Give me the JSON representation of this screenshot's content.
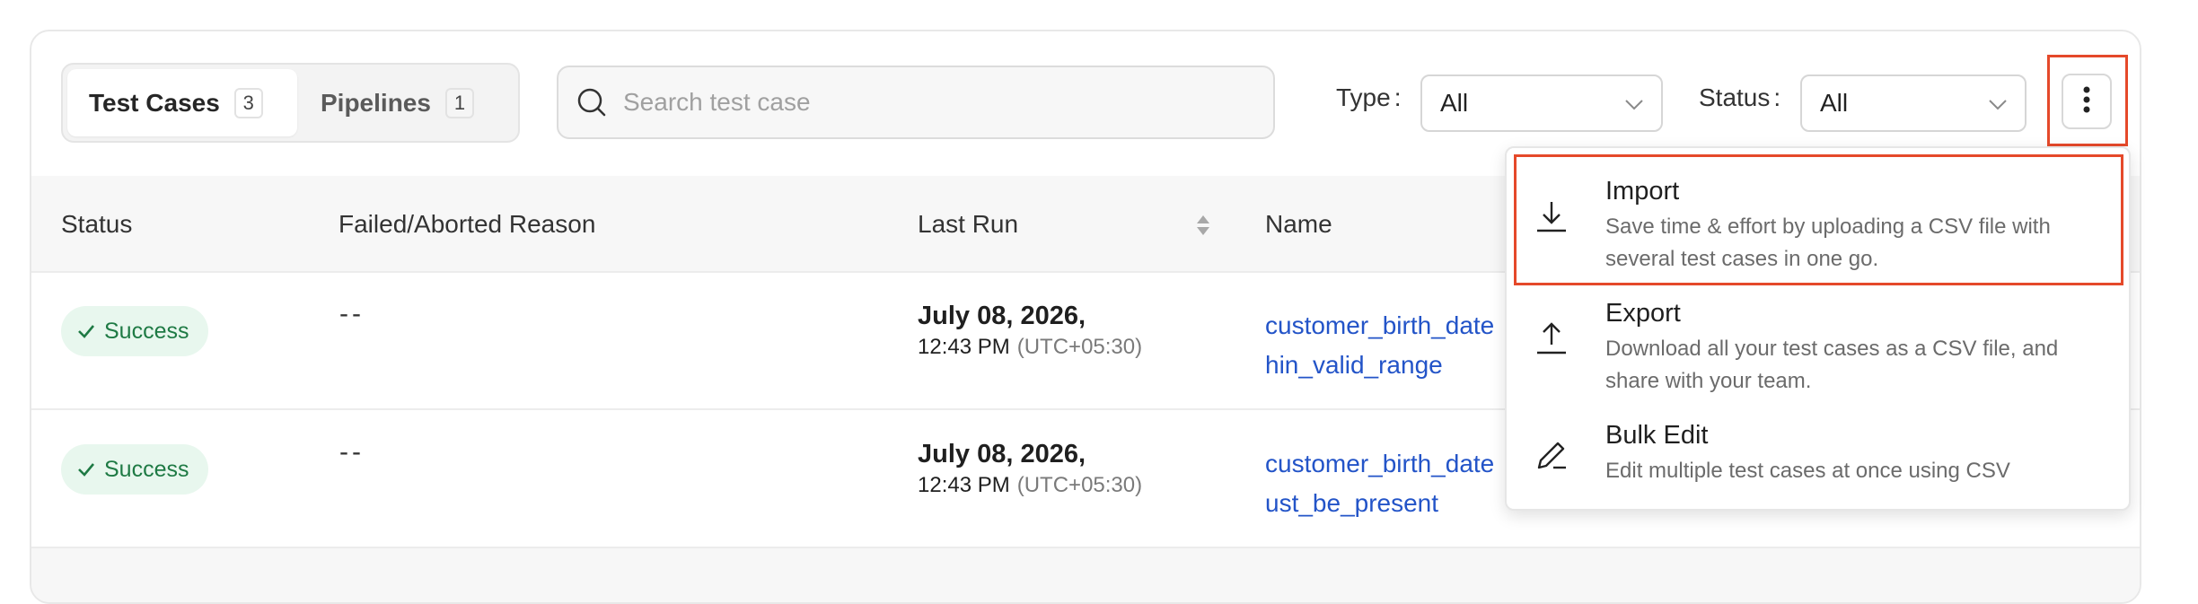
{
  "tabs": [
    {
      "label": "Test Cases",
      "count": "3"
    },
    {
      "label": "Pipelines",
      "count": "1"
    }
  ],
  "search": {
    "placeholder": "Search test case",
    "icon": "search-icon"
  },
  "filters": {
    "type": {
      "label": "Type",
      "colon": ":",
      "value": "All"
    },
    "status": {
      "label": "Status",
      "colon": ":",
      "value": "All"
    }
  },
  "more_button": {
    "icon": "kebab-vertical-icon"
  },
  "table": {
    "headers": [
      "Status",
      "Failed/Aborted Reason",
      "Last Run",
      "Name"
    ],
    "rows": [
      {
        "status": "Success",
        "reason": "--",
        "date": "July 08, 2026,",
        "time": "12:43 PM",
        "tz": "(UTC+05:30)",
        "name_line1": "customer_birth_date",
        "name_line2": "hin_valid_range"
      },
      {
        "status": "Success",
        "reason": "--",
        "date": "July 08, 2026,",
        "time": "12:43 PM",
        "tz": "(UTC+05:30)",
        "name_line1": "customer_birth_date",
        "name_line2": "ust_be_present"
      }
    ]
  },
  "menu": {
    "items": [
      {
        "title": "Import",
        "description": "Save time & effort by uploading a CSV file with several test cases in one go.",
        "icon": "import-download-icon"
      },
      {
        "title": "Export",
        "description": "Download all your test cases as a CSV file, and share with your team.",
        "icon": "export-upload-icon"
      },
      {
        "title": "Bulk Edit",
        "description": "Edit multiple test cases at once using CSV",
        "icon": "pencil-edit-icon"
      }
    ]
  },
  "colors": {
    "highlight": "#e5492a",
    "link": "#2354c8",
    "success_bg": "#e8f7ee",
    "success_text": "#1e7a44"
  }
}
